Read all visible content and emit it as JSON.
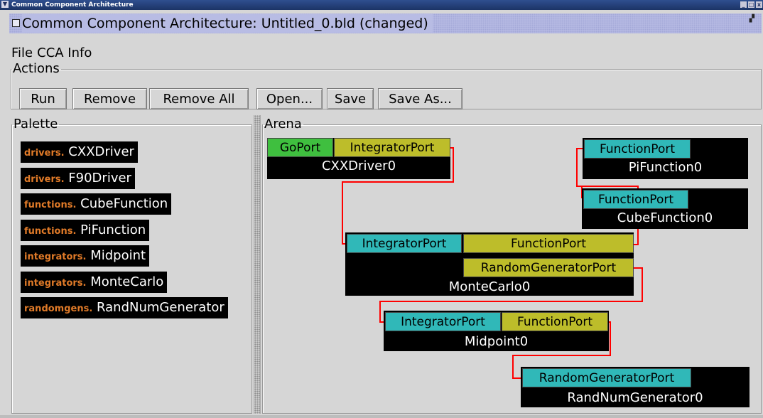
{
  "window": {
    "title": "Common Component Architecture",
    "controls": [
      "_",
      "□",
      "x"
    ]
  },
  "app": {
    "title": "Common Component Architecture: Untitled_0.bld (changed)"
  },
  "menu": [
    "File",
    "CCA Info"
  ],
  "actions": {
    "legend": "Actions",
    "buttons": [
      "Run",
      "Remove",
      "Remove All",
      "Open...",
      "Save",
      "Save As..."
    ]
  },
  "palette": {
    "legend": "Palette",
    "items": [
      {
        "pkg": "drivers.",
        "name": "CXXDriver"
      },
      {
        "pkg": "drivers.",
        "name": "F90Driver"
      },
      {
        "pkg": "functions.",
        "name": "CubeFunction"
      },
      {
        "pkg": "functions.",
        "name": "PiFunction"
      },
      {
        "pkg": "integrators.",
        "name": "Midpoint"
      },
      {
        "pkg": "integrators.",
        "name": "MonteCarlo"
      },
      {
        "pkg": "randomgens.",
        "name": "RandNumGenerator"
      }
    ]
  },
  "arena": {
    "legend": "Arena",
    "components": [
      {
        "name": "CXXDriver0",
        "ports": [
          "GoPort",
          "IntegratorPort"
        ]
      },
      {
        "name": "PiFunction0",
        "ports": [
          "FunctionPort"
        ]
      },
      {
        "name": "CubeFunction0",
        "ports": [
          "FunctionPort"
        ]
      },
      {
        "name": "MonteCarlo0",
        "ports": [
          "IntegratorPort",
          "FunctionPort",
          "RandomGeneratorPort"
        ]
      },
      {
        "name": "Midpoint0",
        "ports": [
          "IntegratorPort",
          "FunctionPort"
        ]
      },
      {
        "name": "RandNumGenerator0",
        "ports": [
          "RandomGeneratorPort"
        ]
      }
    ]
  },
  "colors": {
    "uses_port": "#bdbd2a",
    "provides_port": "#30b8b8",
    "go_port": "#3fbf3f",
    "package_text": "#e07a28",
    "connection": "#ff0000"
  }
}
